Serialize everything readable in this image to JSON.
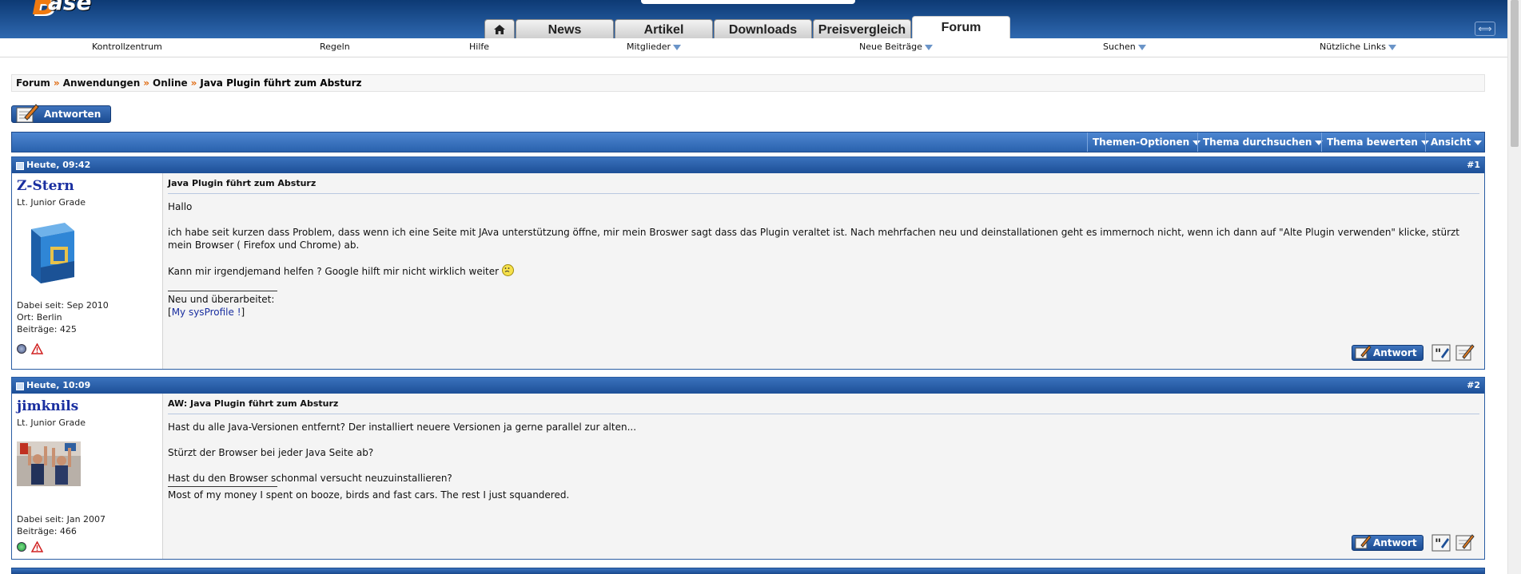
{
  "header": {
    "logo_text": "ase",
    "logo_b": "B",
    "tabs": [
      {
        "label": "News"
      },
      {
        "label": "Artikel"
      },
      {
        "label": "Downloads"
      },
      {
        "label": "Preisvergleich"
      },
      {
        "label": "Forum",
        "active": true
      }
    ]
  },
  "nav": {
    "items": [
      {
        "label": "Kontrollzentrum",
        "dropdown": false
      },
      {
        "label": "Regeln",
        "dropdown": false
      },
      {
        "label": "Hilfe",
        "dropdown": false
      },
      {
        "label": "Mitglieder",
        "dropdown": true
      },
      {
        "label": "Neue Beiträge",
        "dropdown": true
      },
      {
        "label": "Suchen",
        "dropdown": true
      },
      {
        "label": "Nützliche Links",
        "dropdown": true
      }
    ]
  },
  "breadcrumb": {
    "items": [
      "Forum",
      "Anwendungen",
      "Online",
      "Java Plugin führt zum Absturz"
    ],
    "separator": "»"
  },
  "reply_button": "Antworten",
  "thread_toolbar": {
    "items": [
      "Themen-Optionen",
      "Thema durchsuchen",
      "Thema bewerten",
      "Ansicht"
    ]
  },
  "posts": [
    {
      "date": "Heute, 09:42",
      "number": "#1",
      "username": "Z-Stern",
      "usertitle": "Lt. Junior Grade",
      "info": [
        "Dabei seit: Sep 2010",
        "Ort: Berlin",
        "Beiträge: 425"
      ],
      "title": "Java Plugin führt zum Absturz",
      "paragraphs": [
        "Hallo",
        "ich habe seit kurzen dass Problem, dass wenn ich eine Seite mit JAva unterstützung öffne, mir mein Broswer sagt dass das Plugin veraltet ist. Nach mehrfachen neu und deinstallationen geht es immernoch nicht, wenn ich dann auf \"Alte Plugin verwenden\" klicke, stürzt mein Browser ( Firefox und Chrome) ab.",
        "Kann mir irgendjemand helfen ? Google hilft mir nicht wirklich weiter"
      ],
      "signature": {
        "line1": "Neu und überarbeitet:",
        "bracket_open": "[",
        "link": "My sysProfile !",
        "bracket_close": "]"
      },
      "online_status": "offline",
      "reply_label": "Antwort"
    },
    {
      "date": "Heute, 10:09",
      "number": "#2",
      "username": "jimknils",
      "usertitle": "Lt. Junior Grade",
      "info": [
        "Dabei seit: Jan 2007",
        "Beiträge: 466"
      ],
      "title": "AW: Java Plugin führt zum Absturz",
      "paragraphs": [
        "Hast du alle Java-Versionen entfernt? Der installiert neuere Versionen ja gerne parallel zur alten...",
        "Stürzt der Browser bei jeder Java Seite ab?",
        "Hast du den Browser schonmal versucht neuzuinstallieren?"
      ],
      "signature": {
        "line1": "Most of my money I spent on booze, birds and fast cars. The rest I just squandered."
      },
      "online_status": "online",
      "reply_label": "Antwort"
    }
  ],
  "colors": {
    "header_blue": "#1d4f97",
    "accent_orange": "#e06a10",
    "username_blue": "#1a2fa0",
    "online_green": "#22b14c"
  }
}
